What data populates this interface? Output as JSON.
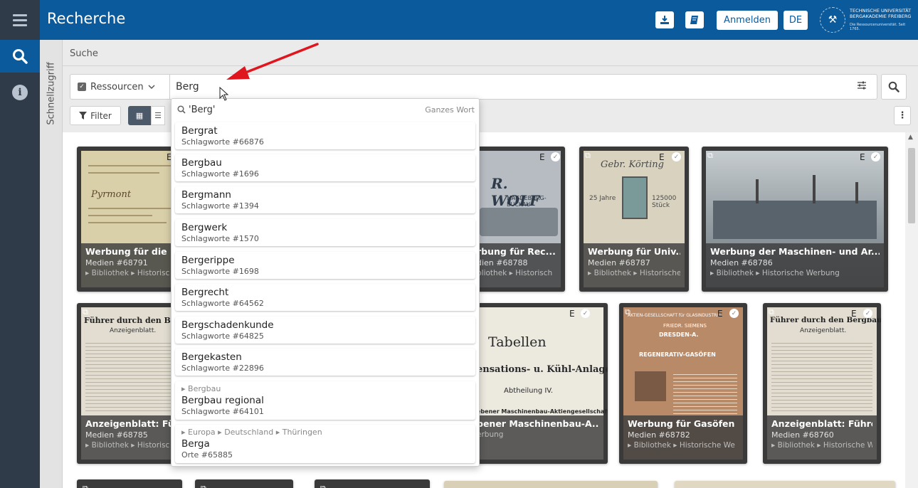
{
  "header": {
    "title": "Recherche",
    "login_label": "Anmelden",
    "language_label": "DE",
    "download_icon": "download-icon",
    "book_icon": "book-icon",
    "logo_line1": "TECHNISCHE UNIVERSITÄT",
    "logo_line2": "BERGAKADEMIE FREIBERG",
    "logo_line3": "Die Ressourcenuniversität. Seit 1765."
  },
  "rail": {
    "quick_access_label": "Schnellzugriff"
  },
  "breadcrumb": "Suche",
  "search": {
    "scope_label": "Ressourcen",
    "query_value": "Berg",
    "filter_label": "Filter"
  },
  "autocomplete": {
    "query": "'Berg'",
    "mode": "Ganzes Wort",
    "items": [
      {
        "label": "Bergrat",
        "meta": "Schlagworte  #66876",
        "parent": ""
      },
      {
        "label": "Bergbau",
        "meta": "Schlagworte  #1696",
        "parent": ""
      },
      {
        "label": "Bergmann",
        "meta": "Schlagworte  #1394",
        "parent": ""
      },
      {
        "label": "Bergwerk",
        "meta": "Schlagworte  #1570",
        "parent": ""
      },
      {
        "label": "Bergerippe",
        "meta": "Schlagworte  #1698",
        "parent": ""
      },
      {
        "label": "Bergrecht",
        "meta": "Schlagworte  #64562",
        "parent": ""
      },
      {
        "label": "Bergschadenkunde",
        "meta": "Schlagworte  #64825",
        "parent": ""
      },
      {
        "label": "Bergekasten",
        "meta": "Schlagworte  #22896",
        "parent": ""
      },
      {
        "label": "Bergbau regional",
        "meta": "Schlagworte  #64101",
        "parent": "▸ Bergbau"
      },
      {
        "label": "Berga",
        "meta": "Orte  #65885",
        "parent": "▸ Europa ▸ Deutschland ▸ Thüringen"
      }
    ]
  },
  "cards": [
    {
      "title": "Werbung für die F",
      "id": "Medien  #68791",
      "path": "▸ Bibliothek ▸ Historisc",
      "e": "E"
    },
    {
      "title": "rbung für Rec...",
      "id": "dien  #68788",
      "path": "bliothek ▸ Historisch",
      "e": "E"
    },
    {
      "title": "Werbung für Univ...",
      "id": "Medien  #68787",
      "path": "▸ Bibliothek ▸ Historische",
      "e": "E"
    },
    {
      "title": "Werbung der Maschinen- und Ar...",
      "id": "Medien  #68786",
      "path": "▸ Bibliothek ▸ Historische Werbung",
      "e": "E"
    },
    {
      "title": "Anzeigenblatt: Führ",
      "id": "Medien  #68785",
      "path": "▸ Bibliothek ▸ Historisc",
      "e": ""
    },
    {
      "title": "bener Maschinenbau-A...",
      "id": "",
      "path": "erbung",
      "e": "E"
    },
    {
      "title": "Werbung für Gasöfen ...",
      "id": "Medien  #68782",
      "path": "▸ Bibliothek ▸ Historische We",
      "e": "E"
    },
    {
      "title": "Anzeigenblatt: Führer...",
      "id": "Medien  #68760",
      "path": "▸ Bibliothek ▸ Historische We",
      "e": "E"
    }
  ],
  "card_images": {
    "c1_title": "Pyrmont",
    "c2_title": "R. WOLF",
    "c2_sub": "MAGDEBURG-BUCKAU",
    "c3_title": "Gebr. Körting",
    "c3_left": "25 Jahre",
    "c3_right": "125000 Stück",
    "c5_title": "Führer durch den Berg",
    "c5_sub": "Anzeigenblatt.",
    "c6_title": "Tabellen",
    "c6_mid": "ensations- u. Kühl-Anlagen",
    "c6_sub": "Abtheilung IV.",
    "c6_bottom": "ebener Maschinenbau-Aktiengesellschaft",
    "c7_title": "AKTIEN-GESELLSCHAFT für GLASINDUSTRIE",
    "c7_sub": "FRIEDR. SIEMENS",
    "c7_city": "DRESDEN-A.",
    "c7_big": "REGENERATIV-GASÖFEN",
    "c8_title": "Führer durch den Bergbau.",
    "c8_sub": "Anzeigenblatt."
  },
  "colors": {
    "brand": "#0b5a9c",
    "rail": "#2f3b49",
    "arrow": "#e0161f"
  }
}
